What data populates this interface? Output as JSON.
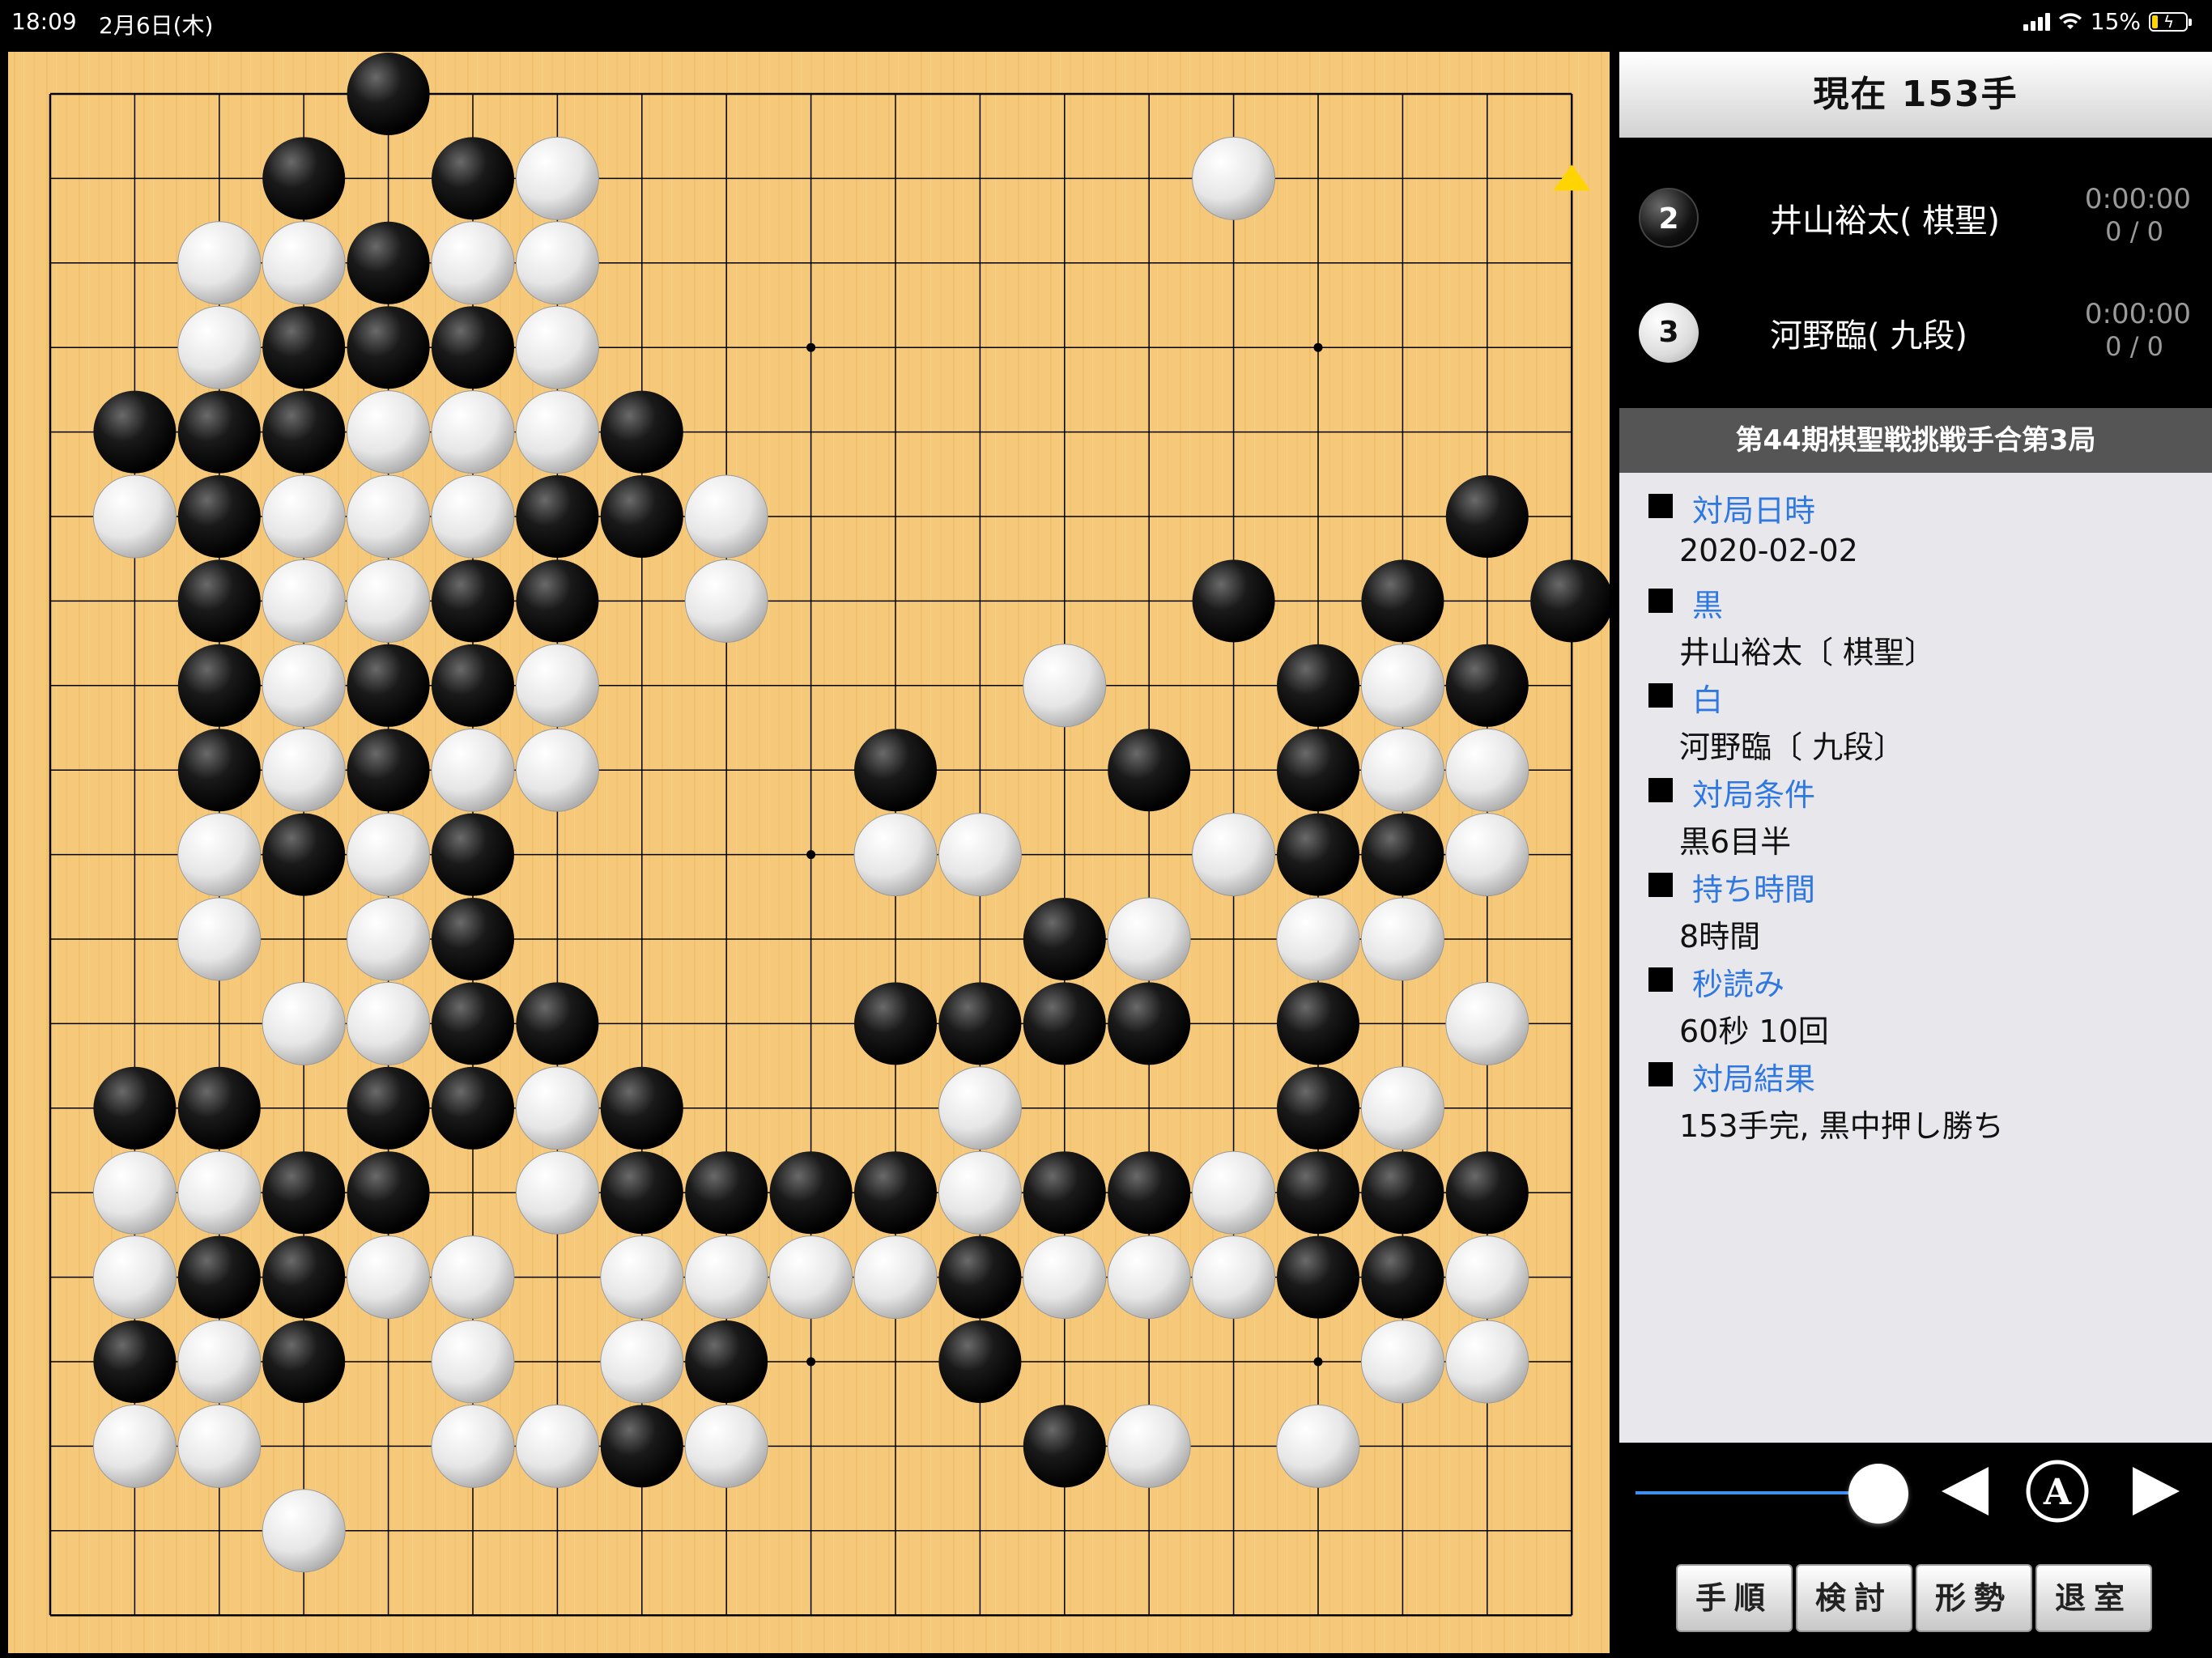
{
  "status_bar": {
    "time": "18:09",
    "date": "2月6日(木)",
    "battery": "15%"
  },
  "board": {
    "size": 19,
    "last_move": [
      18,
      1
    ],
    "black_stones": [
      [
        4,
        0
      ],
      [
        3,
        1
      ],
      [
        5,
        1
      ],
      [
        4,
        2
      ],
      [
        3,
        3
      ],
      [
        4,
        3
      ],
      [
        5,
        3
      ],
      [
        1,
        4
      ],
      [
        2,
        4
      ],
      [
        3,
        4
      ],
      [
        7,
        4
      ],
      [
        2,
        5
      ],
      [
        6,
        5
      ],
      [
        7,
        5
      ],
      [
        17,
        5
      ],
      [
        2,
        6
      ],
      [
        5,
        6
      ],
      [
        6,
        6
      ],
      [
        14,
        6
      ],
      [
        16,
        6
      ],
      [
        18,
        6
      ],
      [
        2,
        7
      ],
      [
        4,
        7
      ],
      [
        5,
        7
      ],
      [
        15,
        7
      ],
      [
        17,
        7
      ],
      [
        2,
        8
      ],
      [
        4,
        8
      ],
      [
        10,
        8
      ],
      [
        13,
        8
      ],
      [
        15,
        8
      ],
      [
        3,
        9
      ],
      [
        5,
        9
      ],
      [
        15,
        9
      ],
      [
        16,
        9
      ],
      [
        5,
        10
      ],
      [
        12,
        10
      ],
      [
        5,
        11
      ],
      [
        6,
        11
      ],
      [
        10,
        11
      ],
      [
        11,
        11
      ],
      [
        12,
        11
      ],
      [
        13,
        11
      ],
      [
        15,
        11
      ],
      [
        1,
        12
      ],
      [
        2,
        12
      ],
      [
        4,
        12
      ],
      [
        5,
        12
      ],
      [
        7,
        12
      ],
      [
        15,
        12
      ],
      [
        3,
        13
      ],
      [
        4,
        13
      ],
      [
        7,
        13
      ],
      [
        8,
        13
      ],
      [
        9,
        13
      ],
      [
        10,
        13
      ],
      [
        12,
        13
      ],
      [
        13,
        13
      ],
      [
        15,
        13
      ],
      [
        16,
        13
      ],
      [
        17,
        13
      ],
      [
        2,
        14
      ],
      [
        3,
        14
      ],
      [
        11,
        14
      ],
      [
        15,
        14
      ],
      [
        16,
        14
      ],
      [
        1,
        15
      ],
      [
        3,
        15
      ],
      [
        8,
        15
      ],
      [
        11,
        15
      ],
      [
        7,
        16
      ],
      [
        12,
        16
      ]
    ],
    "white_stones": [
      [
        6,
        1
      ],
      [
        14,
        1
      ],
      [
        2,
        2
      ],
      [
        3,
        2
      ],
      [
        5,
        2
      ],
      [
        6,
        2
      ],
      [
        2,
        3
      ],
      [
        6,
        3
      ],
      [
        4,
        4
      ],
      [
        5,
        4
      ],
      [
        6,
        4
      ],
      [
        1,
        5
      ],
      [
        3,
        5
      ],
      [
        4,
        5
      ],
      [
        5,
        5
      ],
      [
        8,
        5
      ],
      [
        3,
        6
      ],
      [
        4,
        6
      ],
      [
        8,
        6
      ],
      [
        3,
        7
      ],
      [
        6,
        7
      ],
      [
        12,
        7
      ],
      [
        16,
        7
      ],
      [
        3,
        8
      ],
      [
        5,
        8
      ],
      [
        6,
        8
      ],
      [
        16,
        8
      ],
      [
        17,
        8
      ],
      [
        2,
        9
      ],
      [
        4,
        9
      ],
      [
        10,
        9
      ],
      [
        11,
        9
      ],
      [
        14,
        9
      ],
      [
        17,
        9
      ],
      [
        2,
        10
      ],
      [
        4,
        10
      ],
      [
        13,
        10
      ],
      [
        15,
        10
      ],
      [
        16,
        10
      ],
      [
        3,
        11
      ],
      [
        4,
        11
      ],
      [
        17,
        11
      ],
      [
        6,
        12
      ],
      [
        11,
        12
      ],
      [
        16,
        12
      ],
      [
        1,
        13
      ],
      [
        2,
        13
      ],
      [
        6,
        13
      ],
      [
        11,
        13
      ],
      [
        14,
        13
      ],
      [
        1,
        14
      ],
      [
        4,
        14
      ],
      [
        5,
        14
      ],
      [
        7,
        14
      ],
      [
        8,
        14
      ],
      [
        9,
        14
      ],
      [
        10,
        14
      ],
      [
        12,
        14
      ],
      [
        13,
        14
      ],
      [
        14,
        14
      ],
      [
        17,
        14
      ],
      [
        2,
        15
      ],
      [
        5,
        15
      ],
      [
        7,
        15
      ],
      [
        16,
        15
      ],
      [
        17,
        15
      ],
      [
        1,
        16
      ],
      [
        2,
        16
      ],
      [
        5,
        16
      ],
      [
        6,
        16
      ],
      [
        8,
        16
      ],
      [
        13,
        16
      ],
      [
        15,
        16
      ],
      [
        3,
        17
      ]
    ]
  },
  "panel": {
    "move_title": "現在 153手",
    "players": [
      {
        "badge": "2",
        "name": "井山裕太( 棋聖)",
        "time": "0:00:00",
        "byoyomi": "0 / 0",
        "color": "black"
      },
      {
        "badge": "3",
        "name": "河野臨( 九段)",
        "time": "0:00:00",
        "byoyomi": "0 / 0",
        "color": "white"
      }
    ],
    "game_title": "第44期棋聖戦挑戦手合第3局",
    "info": [
      {
        "label": "対局日時",
        "value": "2020-02-02"
      },
      {
        "label": "黒",
        "value": "井山裕太〔 棋聖〕"
      },
      {
        "label": "白",
        "value": "河野臨〔 九段〕"
      },
      {
        "label": "対局条件",
        "value": "黒6目半"
      },
      {
        "label": "持ち時間",
        "value": "8時間"
      },
      {
        "label": "秒読み",
        "value": "60秒 10回"
      },
      {
        "label": "対局結果",
        "value": "153手完, 黒中押し勝ち"
      }
    ],
    "slider_progress": 1.0,
    "auto_button": "A",
    "buttons": [
      "手順",
      "検討",
      "形勢",
      "退室"
    ]
  },
  "colors": {
    "board": "#f6c97a",
    "link": "#2f78e0",
    "last_move_marker": "#ffd400",
    "slider": "#3d8ff0"
  }
}
